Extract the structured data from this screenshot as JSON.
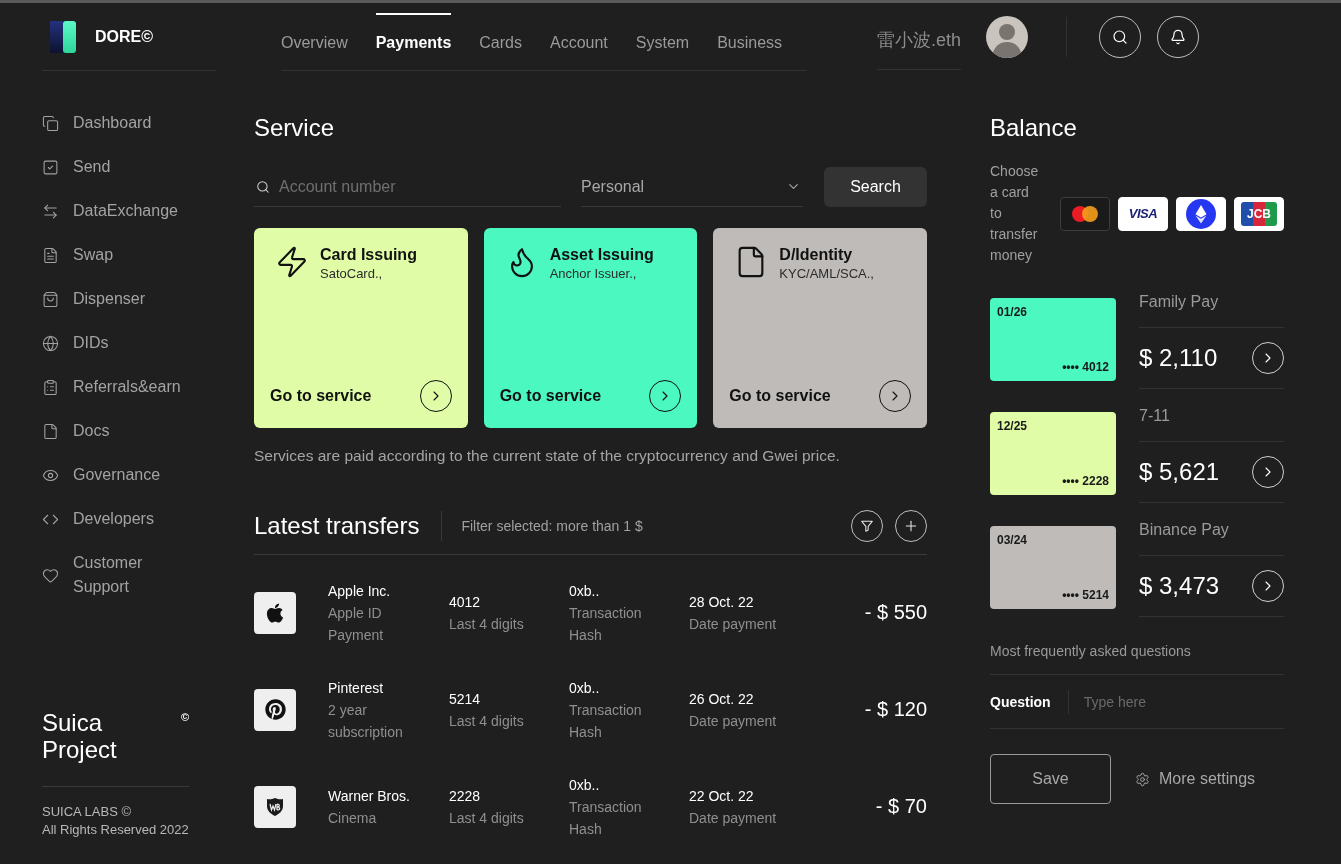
{
  "brand": {
    "name": "DORE©"
  },
  "tabs": [
    {
      "label": "Overview",
      "selected": false
    },
    {
      "label": "Payments",
      "selected": true
    },
    {
      "label": "Cards",
      "selected": false
    },
    {
      "label": "Account",
      "selected": false
    },
    {
      "label": "System",
      "selected": false
    },
    {
      "label": "Business",
      "selected": false
    }
  ],
  "user": {
    "name": "雷小波.eth"
  },
  "sidebar": {
    "items": [
      {
        "kind": "windows",
        "label": "Dashboard",
        "selected": false
      },
      {
        "kind": "check",
        "label": "Send",
        "selected": false
      },
      {
        "kind": "exchange",
        "label": "DataExchange",
        "selected": false
      },
      {
        "kind": "document",
        "label": "Swap",
        "selected": false
      },
      {
        "kind": "bag",
        "label": "Dispenser",
        "selected": false
      },
      {
        "kind": "globe",
        "label": "DIDs",
        "selected": false
      },
      {
        "kind": "clipboard",
        "label": "Referrals&earn",
        "selected": false
      },
      {
        "kind": "file",
        "label": "Docs",
        "selected": false
      },
      {
        "kind": "eye",
        "label": "Governance",
        "selected": false
      },
      {
        "kind": "code",
        "label": "Developers",
        "selected": false
      },
      {
        "kind": "heart",
        "label": "Customer Support",
        "selected": false
      }
    ],
    "footer": {
      "project": "Suica Project",
      "mark": "©",
      "company": "SUICA LABS ©",
      "rights": "All Rights Reserved 2022"
    }
  },
  "service": {
    "title": "Service",
    "search": {
      "placeholder": "Account number"
    },
    "select": {
      "value": "Personal"
    },
    "button": "Search",
    "cards": [
      {
        "kind": "bolt",
        "title": "Card Issuing",
        "subtitle": "SatoCard.,",
        "action": "Go to service",
        "color": "#e0fca6"
      },
      {
        "kind": "flame",
        "title": "Asset Issuing",
        "subtitle": "Anchor Issuer.,",
        "action": "Go to service",
        "color": "#4af8c0"
      },
      {
        "kind": "file",
        "title": "D/Identity",
        "subtitle": "KYC/AML/SCA.,",
        "action": "Go to service",
        "color": "#bebbb9"
      }
    ],
    "note": "Services are paid according to the current state of the cryptocurrency and Gwei price."
  },
  "transfers": {
    "title": "Latest transfers",
    "filter": "Filter selected: more than 1 $",
    "rows": [
      {
        "kind": "apple",
        "merchant": "Apple Inc.",
        "detail": "Apple ID Payment",
        "digits": "4012",
        "digits_label": "Last 4 digits",
        "hash": "0xb..",
        "hash_label": "Transaction Hash",
        "date": "28 Oct. 22",
        "date_label": "Date payment",
        "amount": "- $ 550"
      },
      {
        "kind": "pinterest",
        "merchant": "Pinterest",
        "detail": "2 year subscription",
        "digits": "5214",
        "digits_label": "Last 4 digits",
        "hash": "0xb..",
        "hash_label": "Transaction Hash",
        "date": "26 Oct. 22",
        "date_label": "Date payment",
        "amount": "- $ 120"
      },
      {
        "kind": "shield",
        "merchant": "Warner Bros.",
        "detail": "Cinema",
        "digits": "2228",
        "digits_label": "Last 4 digits",
        "hash": "0xb..",
        "hash_label": "Transaction Hash",
        "date": "22 Oct. 22",
        "date_label": "Date payment",
        "amount": "- $ 70"
      }
    ]
  },
  "balance": {
    "title": "Balance",
    "prompt": "Choose a card to transfer money",
    "brands": [
      {
        "kind": "mastercard",
        "selected": true
      },
      {
        "kind": "visa",
        "label": "VISA",
        "selected": false
      },
      {
        "kind": "ethereum",
        "selected": false
      },
      {
        "kind": "jcb",
        "label": "JCB",
        "selected": false
      }
    ],
    "cards": [
      {
        "expiry": "01/26",
        "number": "•••• 4012",
        "color": "#4af8c0",
        "name": "Family Pay",
        "amount": "$ 2,110"
      },
      {
        "expiry": "12/25",
        "number": "•••• 2228",
        "color": "#e0fca6",
        "name": "7-11",
        "amount": "$ 5,621"
      },
      {
        "expiry": "03/24",
        "number": "•••• 5214",
        "color": "#bebbb9",
        "name": "Binance Pay",
        "amount": "$ 3,473"
      }
    ]
  },
  "faq": {
    "title": "Most frequently asked questions",
    "label": "Question",
    "placeholder": "Type here",
    "save": "Save",
    "more": "More settings"
  }
}
